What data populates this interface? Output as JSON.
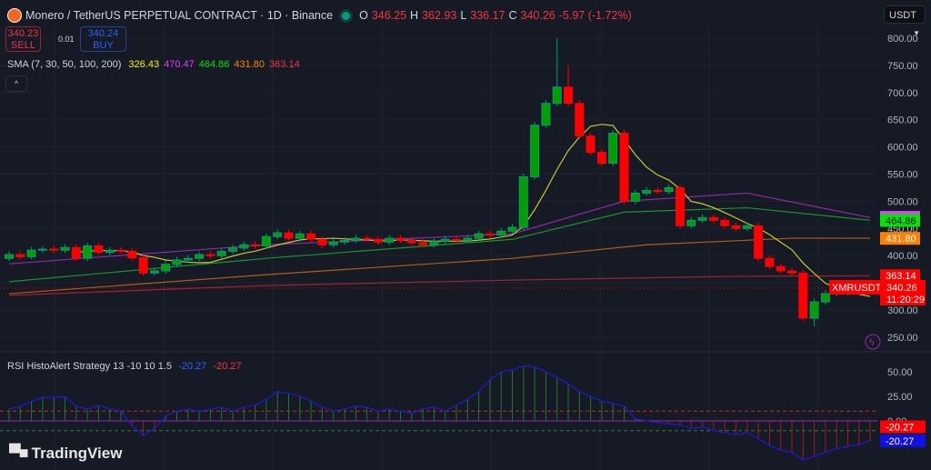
{
  "header": {
    "title": "Monero / TetherUS PERPETUAL CONTRACT · 1D · Binance",
    "o_label": "O",
    "o": "346.25",
    "h_label": "H",
    "h": "362.93",
    "l_label": "L",
    "l": "336.17",
    "c_label": "C",
    "c": "340.26",
    "change": "-5.97 (-1.72%)"
  },
  "trade": {
    "sell_price": "340.23",
    "sell_label": "SELL",
    "spread": "0.01",
    "buy_price": "340.24",
    "buy_label": "BUY"
  },
  "sma": {
    "label": "SMA (7, 30, 50, 100, 200)",
    "values": [
      "326.43",
      "470.47",
      "464.86",
      "431.80",
      "363.14"
    ],
    "colors": [
      "#f5f500",
      "#e040fb",
      "#00e600",
      "#ff8000",
      "#f23645"
    ]
  },
  "currency": "USDT",
  "price_axis": [
    "800.00",
    "750.00",
    "700.00",
    "650.00",
    "600.00",
    "550.00",
    "500.00",
    "450.00",
    "400.00",
    "350.00",
    "300.00",
    "250.00"
  ],
  "price_labels": [
    {
      "text": "470.47",
      "value": 470.47,
      "bg": "#e040fb",
      "fg": "#ffffff"
    },
    {
      "text": "464.86",
      "value": 464.86,
      "bg": "#00e600",
      "fg": "#000000"
    },
    {
      "text": "431.80",
      "value": 431.8,
      "bg": "#ff8000",
      "fg": "#ffffff"
    },
    {
      "text": "363.14",
      "value": 363.14,
      "bg": "#ff0000",
      "fg": "#ffffff"
    },
    {
      "text": "326.43",
      "value": 326.43,
      "bg": "#f5f500",
      "fg": "#000000"
    }
  ],
  "last_price": {
    "symbol": "XMRUSDT.P",
    "price": "340.26",
    "countdown": "11:20:29",
    "value": 340.26
  },
  "rsi": {
    "label": "RSI HistoAlert Strategy 13 -10 10 1.5",
    "v1": "-20.27",
    "v2": "-20.27",
    "axis": [
      "50.00",
      "25.00",
      "0.00"
    ],
    "lbl1": "-20.27",
    "lbl2": "-20.27"
  },
  "brand": "TradingView",
  "chart_data": {
    "type": "candlestick",
    "closes": [
      402,
      398,
      410,
      412,
      410,
      415,
      395,
      418,
      406,
      410,
      408,
      396,
      368,
      372,
      384,
      392,
      395,
      402,
      400,
      408,
      414,
      420,
      418,
      435,
      442,
      432,
      440,
      430,
      420,
      425,
      428,
      432,
      430,
      425,
      432,
      428,
      424,
      420,
      426,
      430,
      428,
      432,
      440,
      438,
      445,
      452,
      545,
      640,
      680,
      710,
      680,
      620,
      590,
      570,
      625,
      500,
      515,
      520,
      518,
      525,
      455,
      465,
      470,
      465,
      455,
      450,
      455,
      395,
      380,
      372,
      368,
      285,
      315,
      330,
      332,
      335,
      338,
      340.26
    ],
    "first_open": 395,
    "sma30": [
      [
        0,
        385
      ],
      [
        23,
        420
      ],
      [
        45,
        440
      ],
      [
        55,
        500
      ],
      [
        66,
        515
      ],
      [
        77,
        470
      ]
    ],
    "sma50": [
      [
        0,
        352
      ],
      [
        23,
        395
      ],
      [
        45,
        430
      ],
      [
        55,
        480
      ],
      [
        66,
        488
      ],
      [
        77,
        465
      ]
    ],
    "sma100": [
      [
        0,
        330
      ],
      [
        23,
        365
      ],
      [
        45,
        395
      ],
      [
        57,
        420
      ],
      [
        70,
        432
      ],
      [
        77,
        432
      ]
    ],
    "sma200": [
      [
        0,
        327
      ],
      [
        23,
        345
      ],
      [
        45,
        355
      ],
      [
        65,
        362
      ],
      [
        77,
        363
      ]
    ],
    "rsi": [
      12,
      15,
      20,
      24,
      24,
      25,
      15,
      12,
      16,
      12,
      10,
      -5,
      -15,
      -8,
      5,
      10,
      12,
      10,
      12,
      14,
      10,
      14,
      16,
      22,
      30,
      28,
      25,
      20,
      14,
      10,
      12,
      15,
      14,
      10,
      12,
      10,
      8,
      12,
      14,
      10,
      16,
      22,
      30,
      42,
      50,
      52,
      56,
      55,
      50,
      44,
      38,
      30,
      25,
      20,
      18,
      15,
      2,
      0,
      -2,
      -3,
      -4,
      -8,
      -6,
      -10,
      -12,
      -14,
      -12,
      -18,
      -25,
      -30,
      -32,
      -40,
      -36,
      -32,
      -28,
      -26,
      -24,
      -20.27
    ],
    "ylim": [
      250,
      800
    ],
    "rsi_ylim": [
      -30,
      60
    ]
  }
}
